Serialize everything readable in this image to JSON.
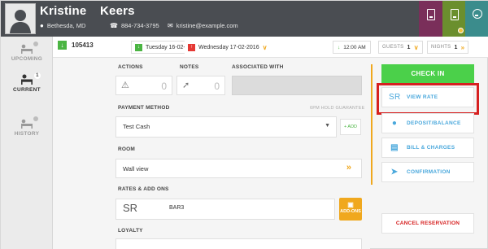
{
  "header": {
    "first_name": "Kristine",
    "last_name": "Keers",
    "location": "Bethesda, MD",
    "phone": "884-734-3795",
    "email": "kristine@example.com"
  },
  "sidebar": {
    "items": [
      {
        "label": "UPCOMING"
      },
      {
        "label": "CURRENT",
        "badge": "1"
      },
      {
        "label": "HISTORY"
      }
    ]
  },
  "reservation": {
    "id": "105413",
    "checkin_date": "Tuesday 16-02-2016",
    "checkout_date": "Wednesday 17-02-2016",
    "time": "12:00 AM",
    "guests_label": "GUESTS",
    "guests_value": "1",
    "nights_label": "NIGHTS",
    "nights_value": "1"
  },
  "form": {
    "actions_label": "ACTIONS",
    "actions_count": "0",
    "notes_label": "NOTES",
    "notes_count": "0",
    "associated_label": "ASSOCIATED WITH",
    "payment_label": "PAYMENT METHOD",
    "payment_note": "6PM HOLD GUARANTEE",
    "payment_value": "Test Cash",
    "add_label": "+ ADD",
    "room_label": "ROOM",
    "room_value": "Wall view",
    "rates_label": "RATES & ADD ONS",
    "rate_code": "SR",
    "rate_name": "BAR3",
    "addons_label": "ADD-ONS",
    "loyalty_label": "LOYALTY"
  },
  "actions_panel": {
    "checkin": "CHECK IN",
    "view_rate_icon": "SR",
    "view_rate": "VIEW RATE",
    "deposit": "DEPOSIT/BALANCE",
    "bill": "BILL & CHARGES",
    "confirmation": "CONFIRMATION",
    "cancel": "CANCEL RESERVATION"
  },
  "colors": {
    "header_bg": "#4a4d52",
    "green": "#4bd04a",
    "orange": "#f0a81e",
    "link_blue": "#4aa8dc",
    "red": "#d62020"
  }
}
